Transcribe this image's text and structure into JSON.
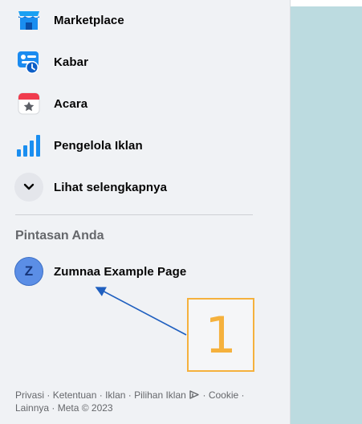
{
  "nav": {
    "items": [
      {
        "label": "Marketplace",
        "icon": "marketplace-icon"
      },
      {
        "label": "Kabar",
        "icon": "news-icon"
      },
      {
        "label": "Acara",
        "icon": "calendar-icon"
      },
      {
        "label": "Pengelola Iklan",
        "icon": "ads-manager-icon"
      },
      {
        "label": "Lihat selengkapnya",
        "icon": "chevron-down-icon"
      }
    ]
  },
  "shortcuts": {
    "title": "Pintasan Anda",
    "items": [
      {
        "label": "Zumnaa Example Page",
        "avatar_letter": "Z"
      }
    ]
  },
  "footer": {
    "privacy": "Privasi",
    "terms": "Ketentuan",
    "ads": "Iklan",
    "ad_choices": "Pilihan Iklan",
    "cookies": "Cookie",
    "more": "Lainnya",
    "copyright": "Meta © 2023",
    "sep": " · "
  },
  "annotation": {
    "number": "1",
    "color": "#f5b13d",
    "arrow_color": "#1f5fbf"
  },
  "colors": {
    "sidebar_bg": "#f0f2f5",
    "accent_blue": "#1877f2",
    "teal_panel": "#bcdbe0"
  }
}
